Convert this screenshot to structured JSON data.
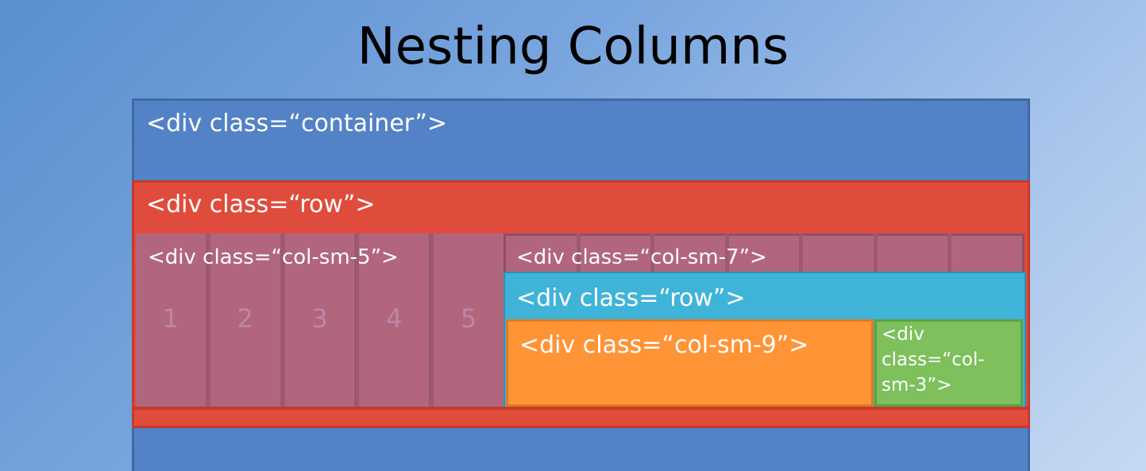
{
  "title": "Nesting Columns",
  "container": {
    "label": "<div class=“container”>"
  },
  "row": {
    "label": "<div class=“row”>"
  },
  "col_sm_5": {
    "label": "<div class=“col-sm-5”>",
    "column_numbers": [
      "1",
      "2",
      "3",
      "4",
      "5"
    ]
  },
  "col_sm_7": {
    "label": "<div class=“col-sm-7”>"
  },
  "nested_row": {
    "label": "<div class=“row”>"
  },
  "col_sm_9": {
    "label": "<div class=“col-sm-9”>"
  },
  "col_sm_3": {
    "label_lines": [
      "<div",
      "class=“col-",
      "sm-3”>"
    ]
  },
  "colors": {
    "container": "#5382c6",
    "row": "#e04c3b",
    "column": "#b2667e",
    "nested_row": "#3fb3d8",
    "col_sm_9": "#ff9437",
    "col_sm_3": "#7dc05c"
  }
}
